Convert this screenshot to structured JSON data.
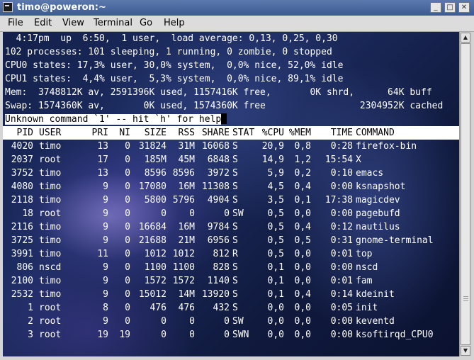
{
  "window": {
    "title": "timo@poweron:~"
  },
  "menu": [
    "File",
    "Edit",
    "View",
    "Terminal",
    "Go",
    "Help"
  ],
  "terminal": {
    "summary": [
      "  4:17pm  up  6:50,  1 user,  load average: 0,13, 0,25, 0,30",
      "102 processes: 101 sleeping, 1 running, 0 zombie, 0 stopped",
      "CPU0 states: 17,3% user, 30,0% system,  0,0% nice, 52,0% idle",
      "CPU1 states:  4,4% user,  5,3% system,  0,0% nice, 89,1% idle",
      "Mem:  3748812K av, 2591396K used, 1157416K free,       0K shrd,      64K buff",
      "Swap: 1574360K av,       0K used, 1574360K free                 2304952K cached"
    ],
    "message": "Unknown command `1' -- hit `h' for help",
    "columns": [
      "PID",
      "USER",
      "PRI",
      "NI",
      "SIZE",
      "RSS",
      "SHARE",
      "STAT",
      "%CPU",
      "%MEM",
      "TIME",
      "COMMAND"
    ],
    "processes": [
      [
        "4020",
        "timo",
        "13",
        "0",
        "31824",
        "31M",
        "16068",
        "S",
        "20,9",
        "0,8",
        "0:28",
        "firefox-bin"
      ],
      [
        "2037",
        "root",
        "17",
        "0",
        "185M",
        "45M",
        "6848",
        "S",
        "14,9",
        "1,2",
        "15:54",
        "X"
      ],
      [
        "3752",
        "timo",
        "13",
        "0",
        "8596",
        "8596",
        "3972",
        "S",
        "5,9",
        "0,2",
        "0:10",
        "emacs"
      ],
      [
        "4080",
        "timo",
        "9",
        "0",
        "17080",
        "16M",
        "11308",
        "S",
        "4,5",
        "0,4",
        "0:00",
        "ksnapshot"
      ],
      [
        "2118",
        "timo",
        "9",
        "0",
        "5800",
        "5796",
        "4904",
        "S",
        "3,5",
        "0,1",
        "17:38",
        "magicdev"
      ],
      [
        "18",
        "root",
        "9",
        "0",
        "0",
        "0",
        "0",
        "SW",
        "0,5",
        "0,0",
        "0:00",
        "pagebufd"
      ],
      [
        "2116",
        "timo",
        "9",
        "0",
        "16684",
        "16M",
        "9784",
        "S",
        "0,5",
        "0,4",
        "0:12",
        "nautilus"
      ],
      [
        "3725",
        "timo",
        "9",
        "0",
        "21688",
        "21M",
        "6956",
        "S",
        "0,5",
        "0,5",
        "0:31",
        "gnome-terminal"
      ],
      [
        "3991",
        "timo",
        "11",
        "0",
        "1012",
        "1012",
        "812",
        "R",
        "0,5",
        "0,0",
        "0:01",
        "top"
      ],
      [
        "806",
        "nscd",
        "9",
        "0",
        "1100",
        "1100",
        "828",
        "S",
        "0,1",
        "0,0",
        "0:00",
        "nscd"
      ],
      [
        "2100",
        "timo",
        "9",
        "0",
        "1572",
        "1572",
        "1140",
        "S",
        "0,1",
        "0,0",
        "0:01",
        "fam"
      ],
      [
        "2532",
        "timo",
        "9",
        "0",
        "15012",
        "14M",
        "13920",
        "S",
        "0,1",
        "0,4",
        "0:14",
        "kdeinit"
      ],
      [
        "1",
        "root",
        "8",
        "0",
        "476",
        "476",
        "432",
        "S",
        "0,0",
        "0,0",
        "0:05",
        "init"
      ],
      [
        "2",
        "root",
        "9",
        "0",
        "0",
        "0",
        "0",
        "SW",
        "0,0",
        "0,0",
        "0:00",
        "keventd"
      ],
      [
        "3",
        "root",
        "19",
        "19",
        "0",
        "0",
        "0",
        "SWN",
        "0,0",
        "0,0",
        "0:00",
        "ksoftirqd_CPU0"
      ]
    ]
  }
}
